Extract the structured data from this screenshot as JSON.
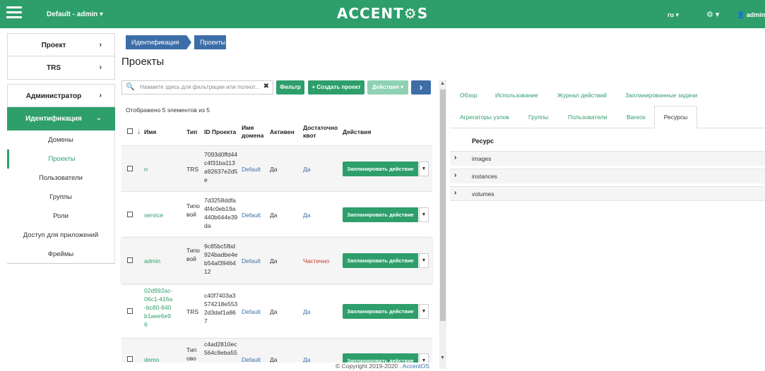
{
  "topbar": {
    "project_selector": "Default - admin ▾",
    "brand": "ACCENT⚙S",
    "lang": "ru ▾",
    "theme": "⚙ ▾",
    "user": "👤 admin ▾"
  },
  "sidebar": {
    "sections": [
      {
        "label": "Проект",
        "arrow": "›"
      },
      {
        "label": "TRS",
        "arrow": "›"
      },
      {
        "label": "Администратор",
        "arrow": "›"
      },
      {
        "label": "Идентификация",
        "arrow": "⌄"
      }
    ],
    "items": [
      "Домены",
      "Проекты",
      "Пользователи",
      "Группы",
      "Роли",
      "Доступ для приложений",
      "Фреймы"
    ]
  },
  "breadcrumb": {
    "items": [
      "Идентификация",
      "Проекты"
    ]
  },
  "page_title": "Проекты",
  "toolbar": {
    "search_placeholder": "Нажмите здесь для фильтрации или полнот...",
    "filter": "Фильтр",
    "create": "+ Создать проект",
    "actions": "Действия ▾",
    "next": "›"
  },
  "count_text": "Отображено 5 элементов из 5",
  "table": {
    "headers": {
      "sort": "⇣",
      "name": "Имя",
      "type": "Тип",
      "project_id": "ID Проекта",
      "domain_name": "Имя домена",
      "active": "Активен",
      "quota": "Достаточно квот",
      "actions": "Действия"
    },
    "rows": [
      {
        "name": "rr",
        "type": "TRS",
        "id": "7093d0ffd44c4f31ba113a92637e2d5e",
        "domain": "Default",
        "active": "Да",
        "quota": "Да",
        "action": "Запланировать действие"
      },
      {
        "name": "service",
        "type": "Типовой",
        "id": "7d3258ddfa4f4c0eb19a440b644e39da",
        "domain": "Default",
        "active": "Да",
        "quota": "Да",
        "action": "Запланировать действие"
      },
      {
        "name": "admin",
        "type": "Типовой",
        "id": "9c85bc5fbd924badbe4eb54af3946412",
        "domain": "Default",
        "active": "Да",
        "quota": "Частично",
        "action": "Запланировать действие"
      },
      {
        "name": "02d992ac-06c1-416a-bc80-840b1aee6e96",
        "type": "TRS",
        "id": "c40f7403a3574218e5532d3daf1a867",
        "domain": "Default",
        "active": "Да",
        "quota": "Да",
        "action": "Запланировать действие"
      },
      {
        "name": "demo",
        "type": "Тип ово",
        "id": "c4ad2810ec564c9eba55",
        "domain": "Default",
        "active": "Да",
        "quota": "Да",
        "action": "Запланировать действие"
      }
    ]
  },
  "detail": {
    "tabs_row1": [
      "Обзор",
      "Использование",
      "Журнал действий",
      "Запланированные задачи"
    ],
    "tabs_row2": [
      "Агрегаторы узлов",
      "Группы",
      "Пользователи",
      "Bareos",
      "Ресурсы"
    ],
    "resource_header": "Ресурс",
    "resources": [
      "images",
      "instances",
      "volumes"
    ]
  },
  "footer": {
    "text": "© Copyright 2019-2020 . ",
    "link": "AccentOS"
  },
  "colors": {
    "accent": "#2e9e6b",
    "blue": "#3d6ea8",
    "warning": "#c0392b"
  }
}
